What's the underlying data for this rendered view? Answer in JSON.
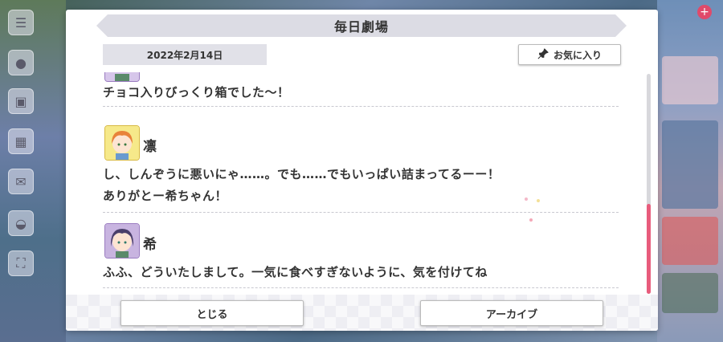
{
  "dialog": {
    "title": "毎日劇場",
    "date": "2022年2月14日",
    "favorite_label": "お気に入り",
    "close_label": "とじる",
    "archive_label": "アーカイブ"
  },
  "entries": [
    {
      "speaker": "",
      "lines": [
        "チョコ入りびっくり箱でした〜！"
      ]
    },
    {
      "speaker": "凛",
      "lines": [
        "し、しんぞうに悪いにゃ……。でも……でもいっぱい詰まってるーー！",
        "ありがとー希ちゃん！"
      ]
    },
    {
      "speaker": "希",
      "lines": [
        "ふふ、どういたしまして。一気に食べすぎないように、気を付けてね"
      ]
    }
  ],
  "colors": {
    "accent": "#e85c7c",
    "title_bg": "#dcdce4",
    "rin_avatar_bg": "#f6e98a",
    "nozomi_avatar_bg": "#c8b4e0"
  },
  "icons": {
    "favorite": "pushpin-icon"
  }
}
